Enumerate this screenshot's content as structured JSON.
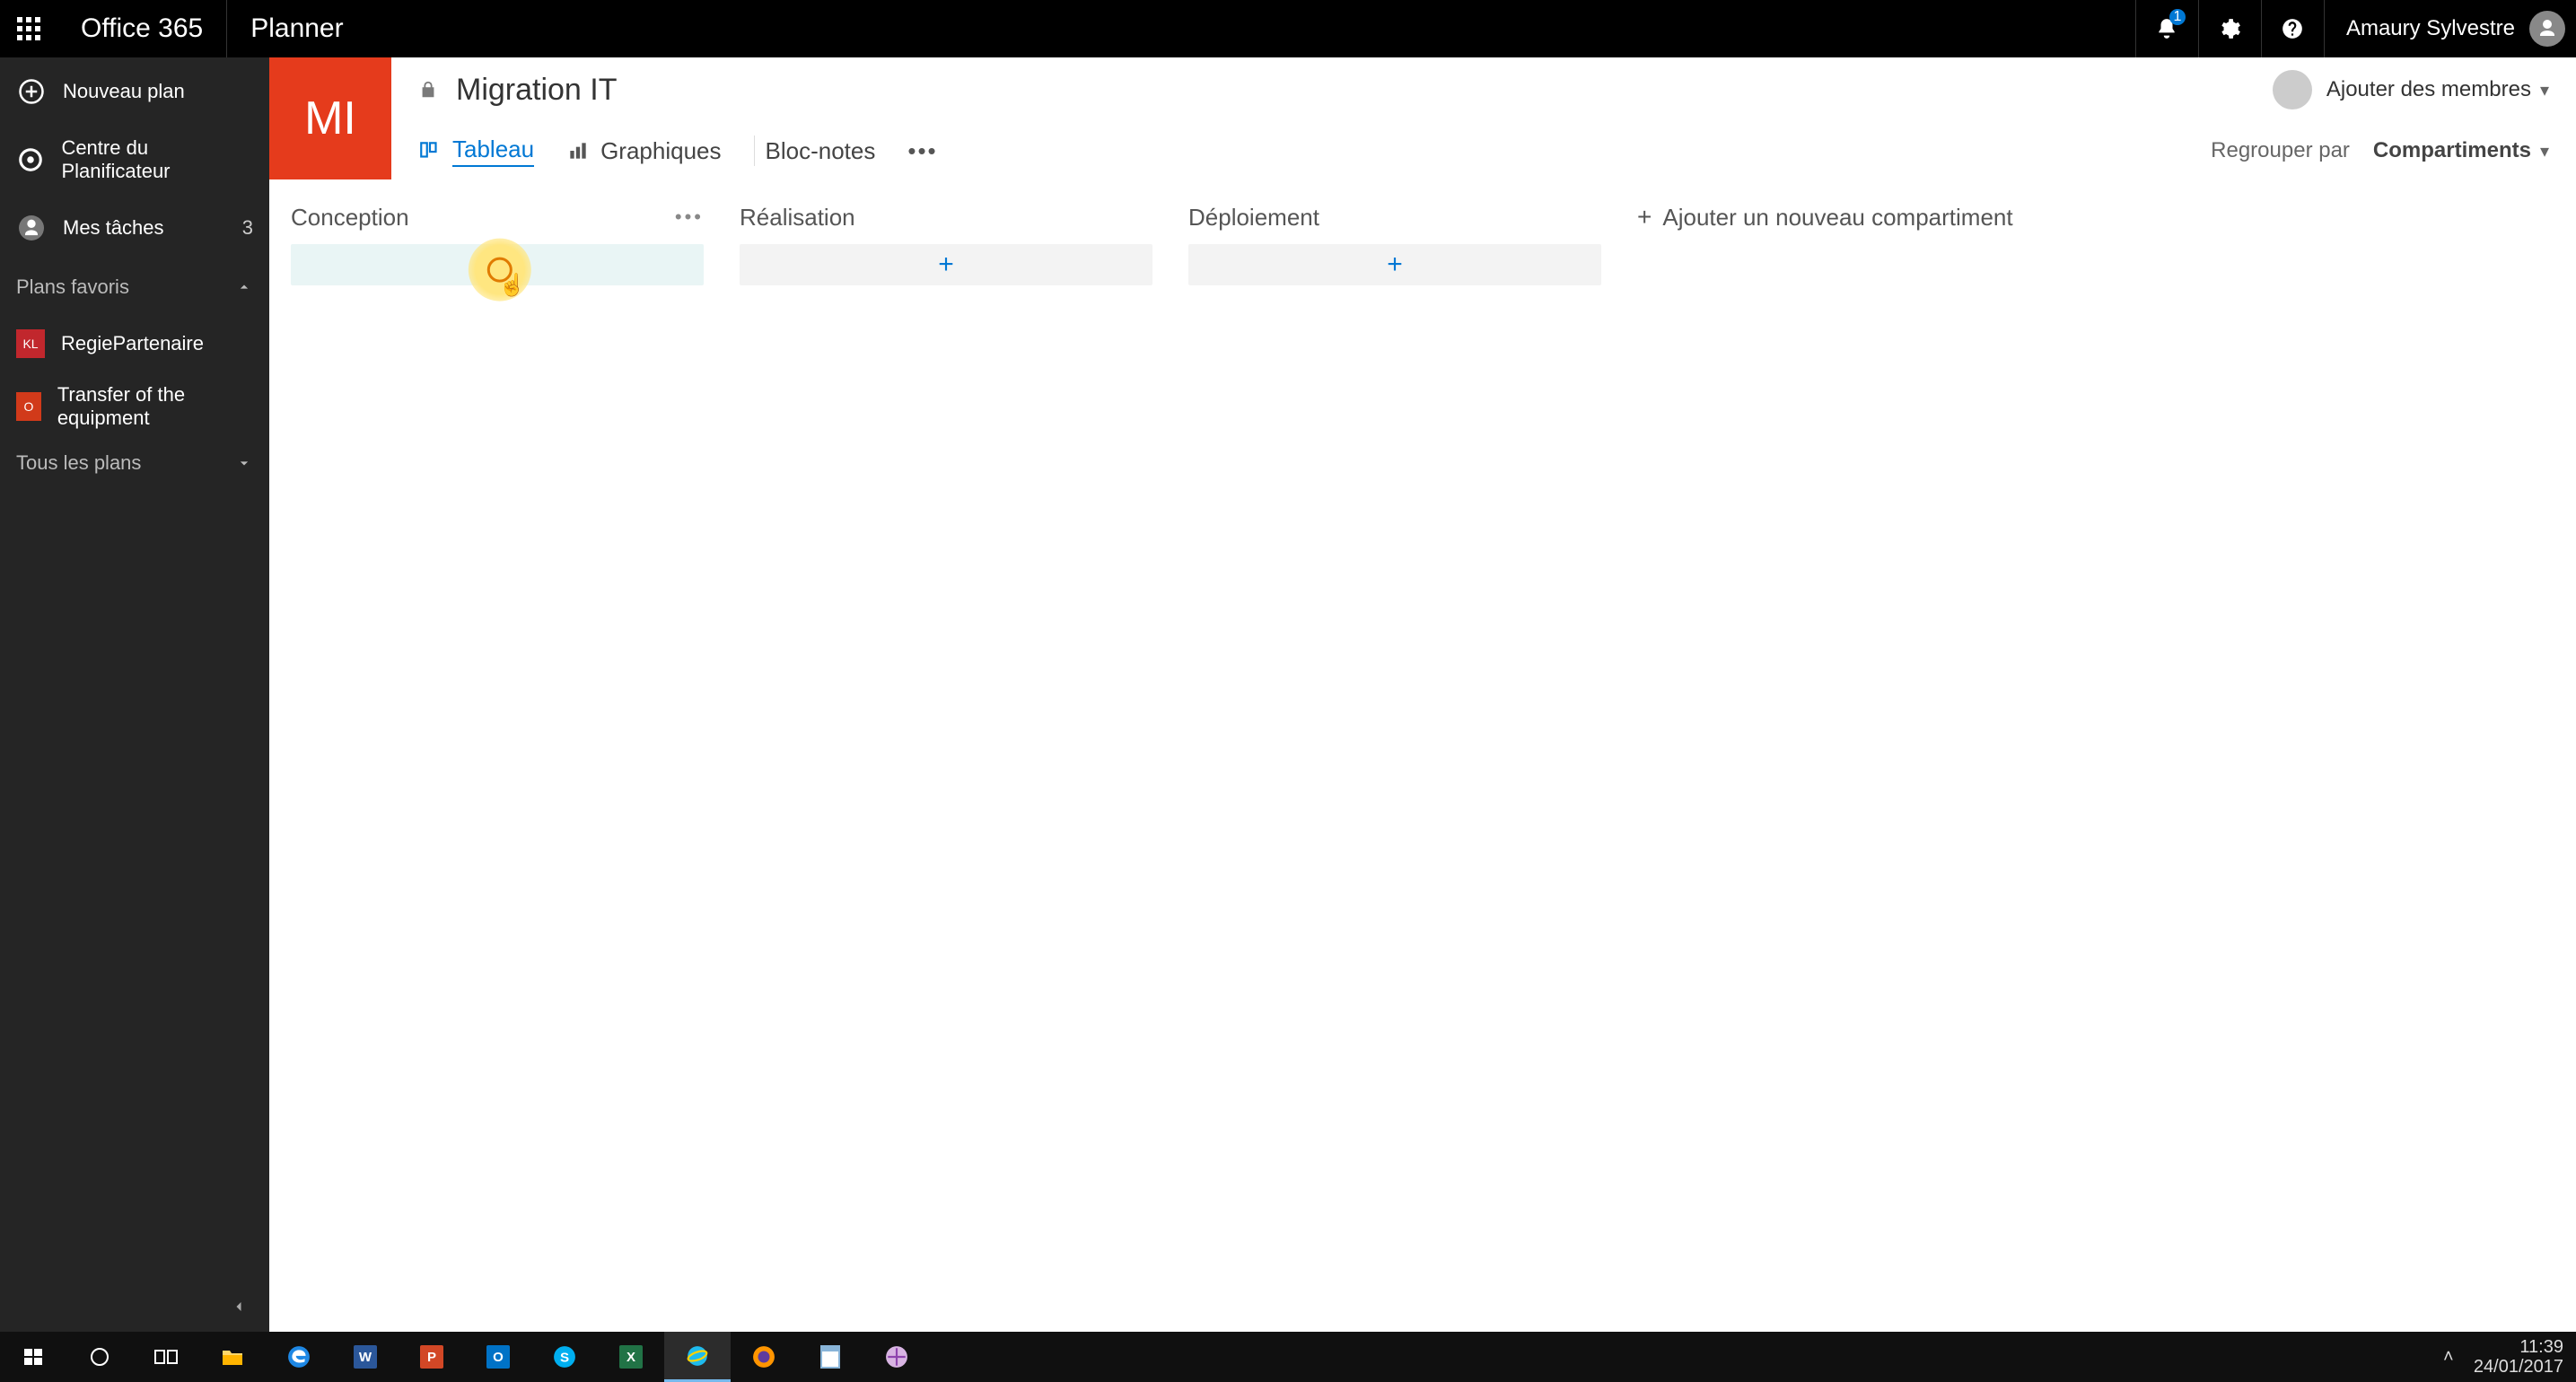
{
  "o365": {
    "brand": "Office 365",
    "app": "Planner",
    "notification_count": "1",
    "user_name": "Amaury Sylvestre"
  },
  "leftnav": {
    "new_plan": "Nouveau plan",
    "hub": "Centre du Planificateur",
    "my_tasks": "Mes tâches",
    "my_tasks_count": "3",
    "fav_section": "Plans favoris",
    "plans": [
      {
        "chip": "KL",
        "chip_color": "#c1272d",
        "label": "RegiePartenaire"
      },
      {
        "chip": "O",
        "chip_color": "#d13a1a",
        "label": "Transfer of the equipment"
      }
    ],
    "all_plans": "Tous les plans"
  },
  "plan": {
    "tile_initials": "MI",
    "title": "Migration IT",
    "add_members": "Ajouter des membres",
    "tabs": {
      "board": "Tableau",
      "charts": "Graphiques",
      "notes": "Bloc-notes"
    },
    "group_by_label": "Regrouper par",
    "group_by_value": "Compartiments"
  },
  "board": {
    "buckets": [
      {
        "name": "Conception",
        "show_menu": true,
        "hover": true
      },
      {
        "name": "Réalisation",
        "show_menu": false,
        "hover": false
      },
      {
        "name": "Déploiement",
        "show_menu": false,
        "hover": false
      }
    ],
    "new_bucket": "Ajouter un nouveau compartiment"
  },
  "taskbar": {
    "time": "11:39",
    "date": "24/01/2017"
  }
}
